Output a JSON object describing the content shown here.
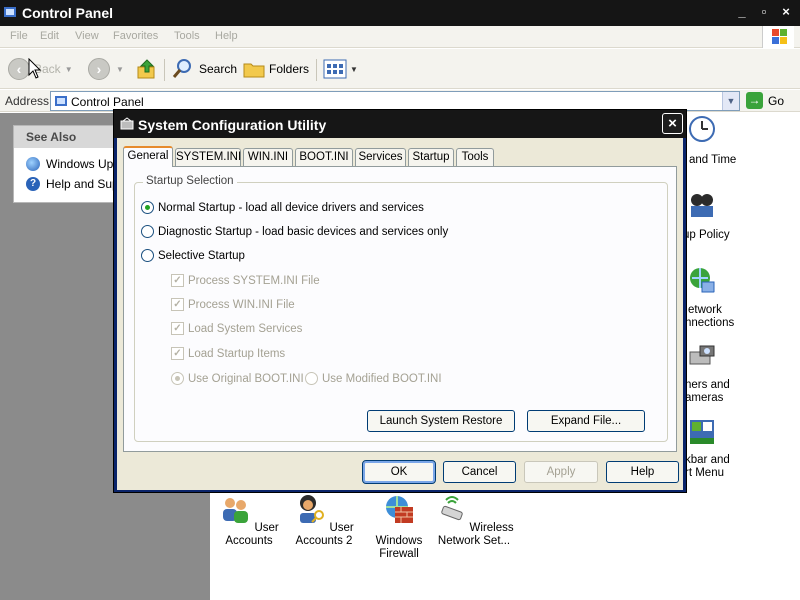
{
  "window": {
    "title": "Control Panel",
    "controls": {
      "minimize": "_",
      "maximize": "▫",
      "close": "×"
    }
  },
  "menu": [
    "File",
    "Edit",
    "View",
    "Favorites",
    "Tools",
    "Help"
  ],
  "toolbar": {
    "back_label": "Back",
    "search_label": "Search",
    "folders_label": "Folders"
  },
  "address": {
    "label": "Address",
    "value": "Control Panel",
    "go_label": "Go"
  },
  "see_also": {
    "header": "See Also",
    "links": [
      "Windows Upd",
      "Help and Supp"
    ]
  },
  "cp_items": [
    {
      "label": "User Accounts",
      "icon": "users-icon"
    },
    {
      "label": "User Accounts 2",
      "icon": "user-keys-icon"
    },
    {
      "label": "Windows Firewall",
      "icon": "firewall-icon"
    },
    {
      "label": "Wireless Network Set...",
      "icon": "wireless-icon"
    }
  ],
  "cp_partial_labels": [
    "and Time",
    "up Policy",
    "etwork",
    "nnections",
    "ners and",
    "ameras",
    "kbar and",
    "rt Menu"
  ],
  "dialog": {
    "title": "System Configuration Utility",
    "close": "×",
    "tabs": [
      "General",
      "SYSTEM.INI",
      "WIN.INI",
      "BOOT.INI",
      "Services",
      "Startup",
      "Tools"
    ],
    "active_tab": "General",
    "group_label": "Startup Selection",
    "options": [
      {
        "label": "Normal Startup - load all device drivers and services",
        "selected": true
      },
      {
        "label": "Diagnostic Startup - load basic devices and services only",
        "selected": false
      },
      {
        "label": "Selective Startup",
        "selected": false
      }
    ],
    "selective": [
      {
        "label": "Process SYSTEM.INI File",
        "checked": true
      },
      {
        "label": "Process WIN.INI File",
        "checked": true
      },
      {
        "label": "Load System Services",
        "checked": true
      },
      {
        "label": "Load Startup Items",
        "checked": true
      }
    ],
    "boot_options": [
      "Use Original BOOT.INI",
      "Use Modified BOOT.INI"
    ],
    "buttons": {
      "launch_restore": "Launch System Restore",
      "expand_file": "Expand File...",
      "ok": "OK",
      "cancel": "Cancel",
      "apply": "Apply",
      "help": "Help"
    }
  },
  "colors": {
    "titlebar": "#161616",
    "dialog_bg": "#ece9d8",
    "panel_bg": "#fcfcfe",
    "left_pane": "#8b8b8b",
    "tab_accent": "#e68b2c",
    "radio_selected": "#21a121"
  }
}
